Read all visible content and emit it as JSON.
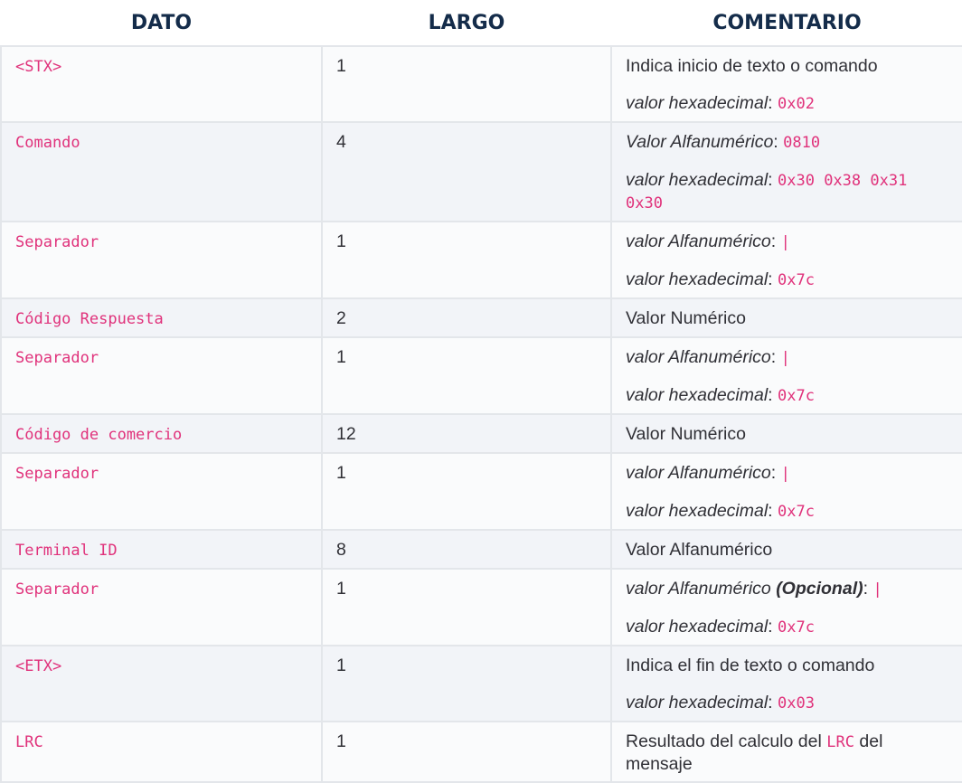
{
  "headers": {
    "dato": "DATO",
    "largo": "LARGO",
    "comentario": "COMENTARIO"
  },
  "labels": {
    "inicio": "Indica inicio de texto o comando",
    "fin": "Indica el fin de texto o comando",
    "hex": "valor hexadecimal",
    "alfa_cap": "Valor Alfanumérico",
    "alfa": "valor Alfanumérico",
    "opcional": "(Opcional)",
    "numerico": "Valor Numérico",
    "alfanumerico": "Valor Alfanumérico",
    "resultado_pre": "Resultado del calculo del",
    "resultado_post": "del",
    "mensaje": "mensaje",
    "colon": ":"
  },
  "rows": [
    {
      "dato": "<STX>",
      "largo": "1",
      "hex": "0x02"
    },
    {
      "dato": "Comando",
      "largo": "4",
      "alfa": "0810",
      "hex": "0x30 0x38 0x31 0x30"
    },
    {
      "dato": "Separador",
      "largo": "1",
      "alfa": "|",
      "hex": "0x7c"
    },
    {
      "dato": "Código Respuesta",
      "largo": "2"
    },
    {
      "dato": "Separador",
      "largo": "1",
      "alfa": "|",
      "hex": "0x7c"
    },
    {
      "dato": "Código de comercio",
      "largo": "12"
    },
    {
      "dato": "Separador",
      "largo": "1",
      "alfa": "|",
      "hex": "0x7c"
    },
    {
      "dato": "Terminal ID",
      "largo": "8"
    },
    {
      "dato": "Separador",
      "largo": "1",
      "alfa": "|",
      "hex": "0x7c"
    },
    {
      "dato": "<ETX>",
      "largo": "1",
      "hex": "0x03"
    },
    {
      "dato": "LRC",
      "largo": "1",
      "code": "LRC"
    }
  ]
}
